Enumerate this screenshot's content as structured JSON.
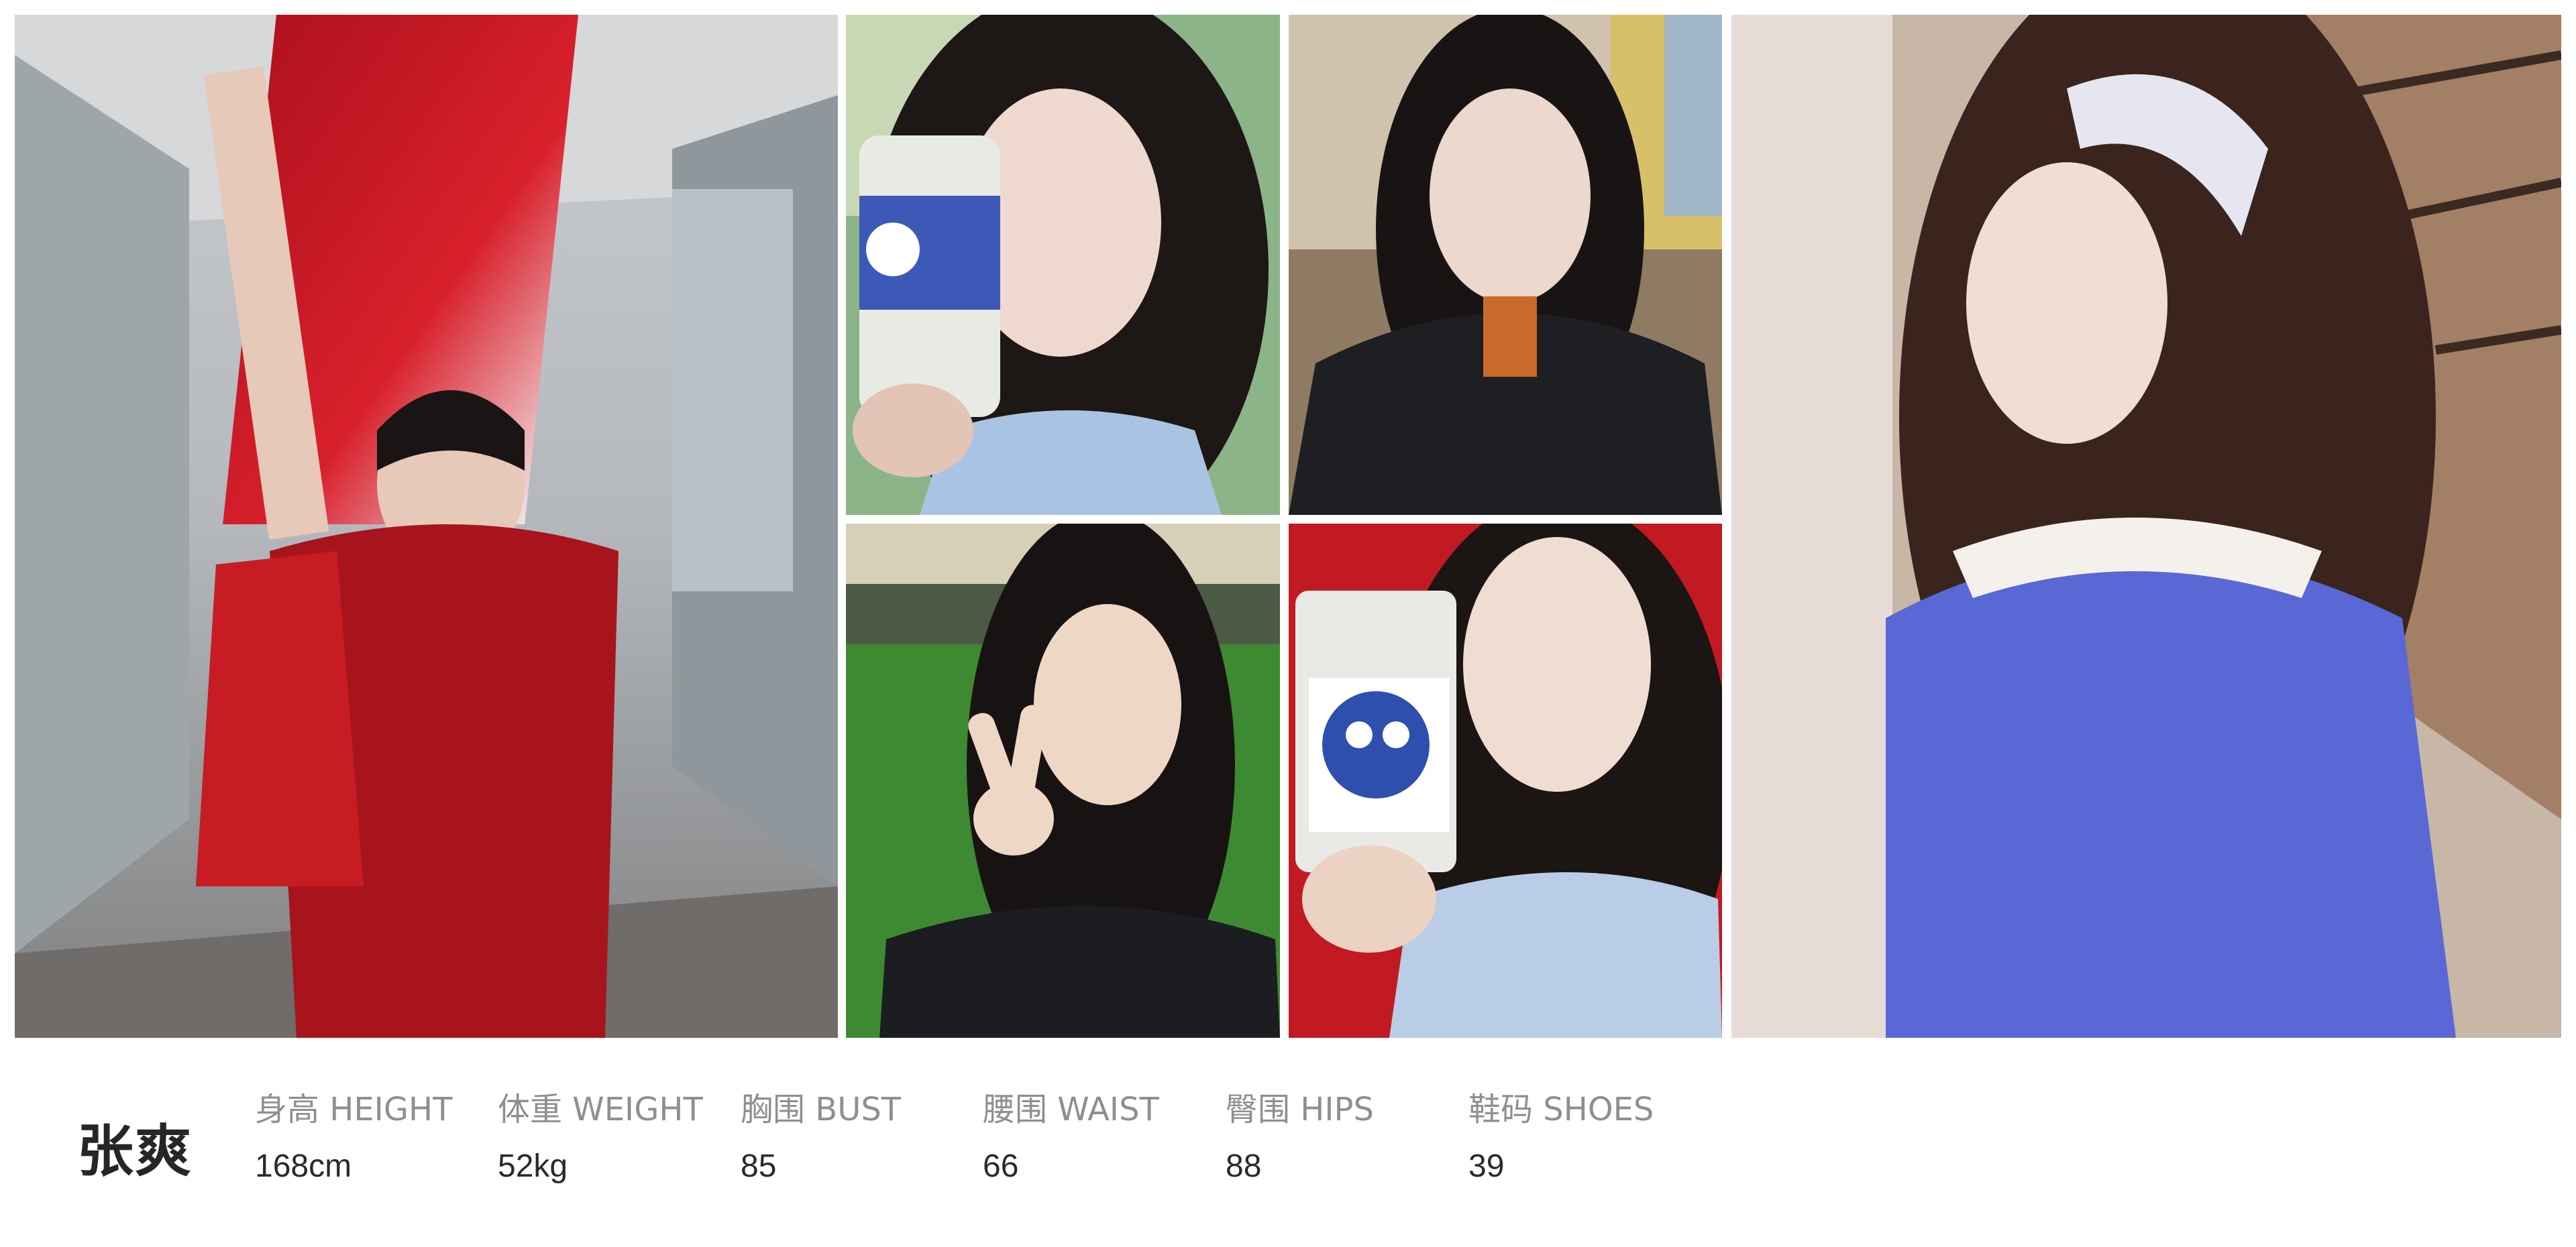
{
  "model": {
    "name": "张爽"
  },
  "measurements": [
    {
      "label": "身高 HEIGHT",
      "value": "168cm"
    },
    {
      "label": "体重 WEIGHT",
      "value": "52kg"
    },
    {
      "label": "胸围 BUST",
      "value": "85"
    },
    {
      "label": "腰围 WAIST",
      "value": "66"
    },
    {
      "label": "臀围 HIPS",
      "value": "88"
    },
    {
      "label": "鞋码 SHOES",
      "value": "39"
    }
  ],
  "colors": {
    "label": "#8f8f8f",
    "value": "#2a2a2a",
    "name": "#262626",
    "background": "#ffffff"
  }
}
